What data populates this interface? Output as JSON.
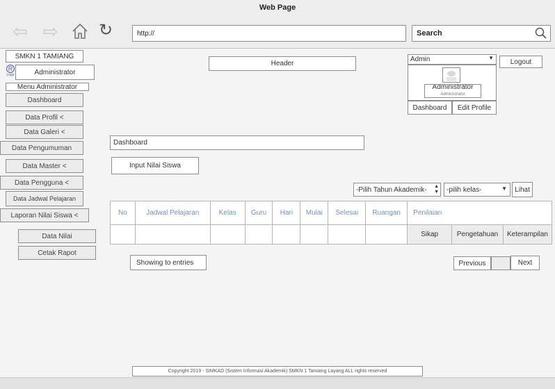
{
  "browser": {
    "title": "Web Page",
    "url": "http://",
    "search_label": "Search"
  },
  "sidebar": {
    "school": "SMKN 1 TAMIANG",
    "logo_letter": "R",
    "logo_text": "Logo",
    "user": "Administrator",
    "menu_title": "Menu Administrator",
    "items": [
      "Dashboard",
      "Data Profil <",
      "Data Galeri <",
      "Data Pengumuman",
      "Data Master <",
      "Data Pengguna <",
      "Data Jadwal Pelajaran",
      "Laporan Nilai Siswa <",
      "Data Nilai",
      "Cetak Rapot"
    ]
  },
  "header": {
    "label": "Header"
  },
  "account": {
    "role_select": "Admin",
    "logout": "Logout",
    "name": "Administrator",
    "subtitle": "Administrator",
    "dashboard_link": "Dashboard",
    "edit_profile_link": "Edit Profile"
  },
  "main": {
    "breadcrumb": "Dashboard",
    "input_button": "Input Nilai Siswa",
    "filter_year": "-Pilih Tahun Akademik-",
    "filter_class": "-pilih kelas-",
    "view_button": "Lihat",
    "columns": [
      "No",
      "Jadwal Pelajaran",
      "Kelas",
      "Guru",
      "Hari",
      "Mulai",
      "Selesai",
      "Ruangan",
      "Penilaian"
    ],
    "grade_buttons": [
      "Sikap",
      "Pengetahuan",
      "Keterampilan"
    ],
    "showing": "Showing to entries",
    "prev": "Previous",
    "next": "Next"
  },
  "footer": {
    "copyright": "Copyright 2019 - SIMKAD (Sistem Informasi Akademik) SMKN 1 Tamiang Layang ALL rights reserved"
  }
}
